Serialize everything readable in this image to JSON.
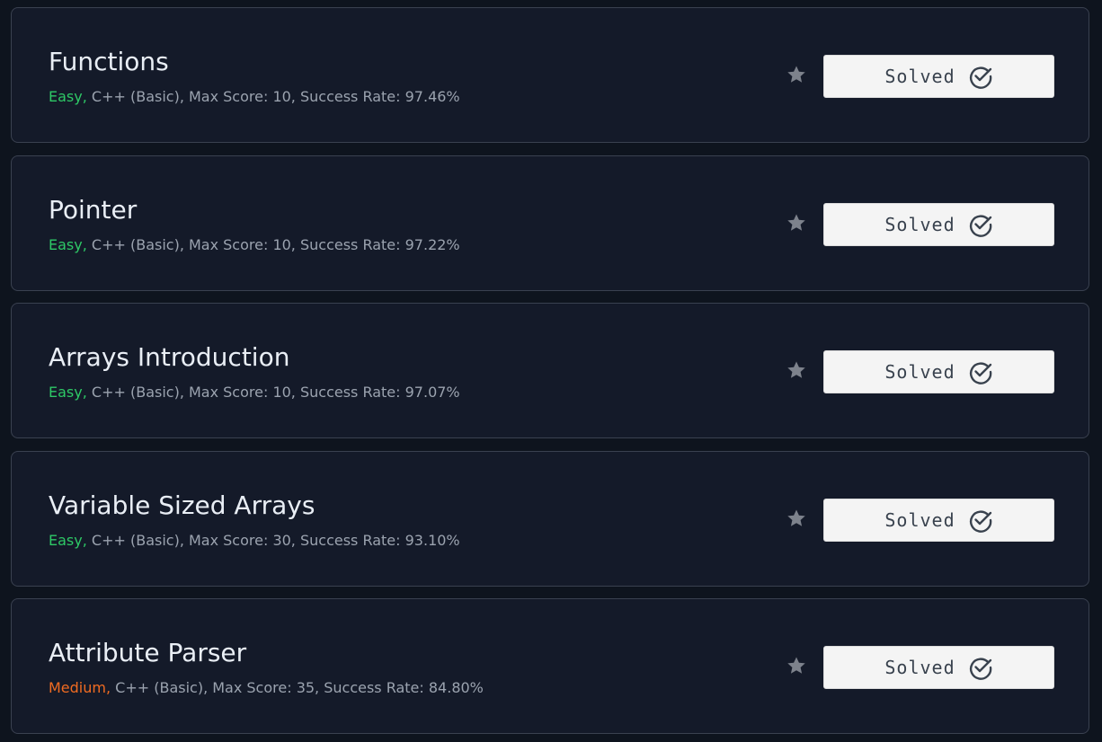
{
  "challenges": [
    {
      "title": "Functions",
      "difficulty": "Easy,",
      "difficulty_level": "easy",
      "details": " C++ (Basic), Max Score: 10, Success Rate: 97.46%",
      "status": "Solved",
      "star_icon": "star-icon",
      "check_icon": "check-circle-icon"
    },
    {
      "title": "Pointer",
      "difficulty": "Easy,",
      "difficulty_level": "easy",
      "details": " C++ (Basic), Max Score: 10, Success Rate: 97.22%",
      "status": "Solved",
      "star_icon": "star-icon",
      "check_icon": "check-circle-icon"
    },
    {
      "title": "Arrays Introduction",
      "difficulty": "Easy,",
      "difficulty_level": "easy",
      "details": " C++ (Basic), Max Score: 10, Success Rate: 97.07%",
      "status": "Solved",
      "star_icon": "star-icon",
      "check_icon": "check-circle-icon"
    },
    {
      "title": "Variable Sized Arrays",
      "difficulty": "Easy,",
      "difficulty_level": "easy",
      "details": " C++ (Basic), Max Score: 30, Success Rate: 93.10%",
      "status": "Solved",
      "star_icon": "star-icon",
      "check_icon": "check-circle-icon"
    },
    {
      "title": "Attribute Parser",
      "difficulty": "Medium,",
      "difficulty_level": "medium",
      "details": " C++ (Basic), Max Score: 35, Success Rate: 84.80%",
      "status": "Solved",
      "star_icon": "star-icon",
      "check_icon": "check-circle-icon"
    }
  ],
  "colors": {
    "background": "#0e141e",
    "card": "#141a29",
    "easy": "#2ec866",
    "medium": "#f06b21",
    "button": "#f4f4f4"
  }
}
